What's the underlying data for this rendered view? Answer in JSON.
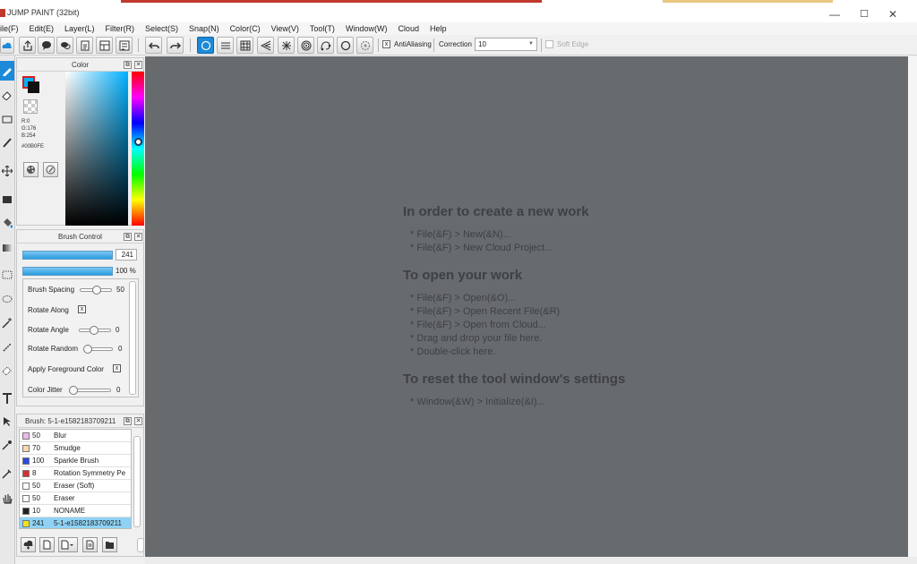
{
  "window": {
    "title": "JUMP PAINT (32bit)",
    "minimize": "—",
    "maximize": "☐",
    "close": "✕",
    "accent": "#1c8ad8"
  },
  "menu": [
    "ile(F)",
    "Edit(E)",
    "Layer(L)",
    "Filter(R)",
    "Select(S)",
    "Snap(N)",
    "Color(C)",
    "View(V)",
    "Tool(T)",
    "Window(W)",
    "Cloud",
    "Help"
  ],
  "toolbar": {
    "antialiasing_label": "AntiAliasing",
    "correction_label": "Correction",
    "correction_value": "10",
    "soft_edge_label": "Soft Edge"
  },
  "color_panel": {
    "title": "Color",
    "r": "R:0",
    "g": "G:176",
    "b": "B:254",
    "hex": "#00B0FE",
    "fg_color": "#00b0fe",
    "bg_color": "#111111"
  },
  "brush_control": {
    "title": "Brush Control",
    "size_value": "241",
    "opacity_value": "100 %",
    "rows": [
      {
        "label": "Brush Spacing",
        "value": "50"
      },
      {
        "label": "Rotate Along",
        "checked": "x"
      },
      {
        "label": "Rotate Angle",
        "value": "0"
      },
      {
        "label": "Rotate Random",
        "value": "0"
      },
      {
        "label": "Apply Foreground Color",
        "checked": "x"
      },
      {
        "label": "Color Jitter",
        "value": "0"
      }
    ]
  },
  "brush_panel": {
    "title": "Brush: 5-1-e1582183709211",
    "items": [
      {
        "size": "50",
        "name": "Blur",
        "color": "#f0b8f0"
      },
      {
        "size": "70",
        "name": "Smudge",
        "color": "#f8d8b0"
      },
      {
        "size": "100",
        "name": "Sparkle Brush",
        "color": "#2a4ad8"
      },
      {
        "size": "8",
        "name": "Rotation Symmetry Pe",
        "color": "#d83030"
      },
      {
        "size": "50",
        "name": "Eraser (Soft)",
        "color": "#ffffff"
      },
      {
        "size": "50",
        "name": "Eraser",
        "color": "#ffffff"
      },
      {
        "size": "10",
        "name": "NONAME",
        "color": "#222222"
      },
      {
        "size": "241",
        "name": "5-1-e1582183709211",
        "color": "#f0e020",
        "selected": true
      }
    ]
  },
  "canvas": {
    "sections": [
      {
        "heading": "In order to create a new work",
        "lines": [
          "* File(&F) > New(&N)...",
          "* File(&F) > New Cloud Project..."
        ]
      },
      {
        "heading": "To open your work",
        "lines": [
          "* File(&F) > Open(&O)...",
          "* File(&F) > Open Recent File(&R)",
          "* File(&F) > Open from Cloud...",
          "* Drag and drop your file here.",
          "* Double-click here."
        ]
      },
      {
        "heading": "To reset the tool window's settings",
        "lines": [
          "* Window(&W) > Initialize(&I)..."
        ]
      }
    ]
  }
}
